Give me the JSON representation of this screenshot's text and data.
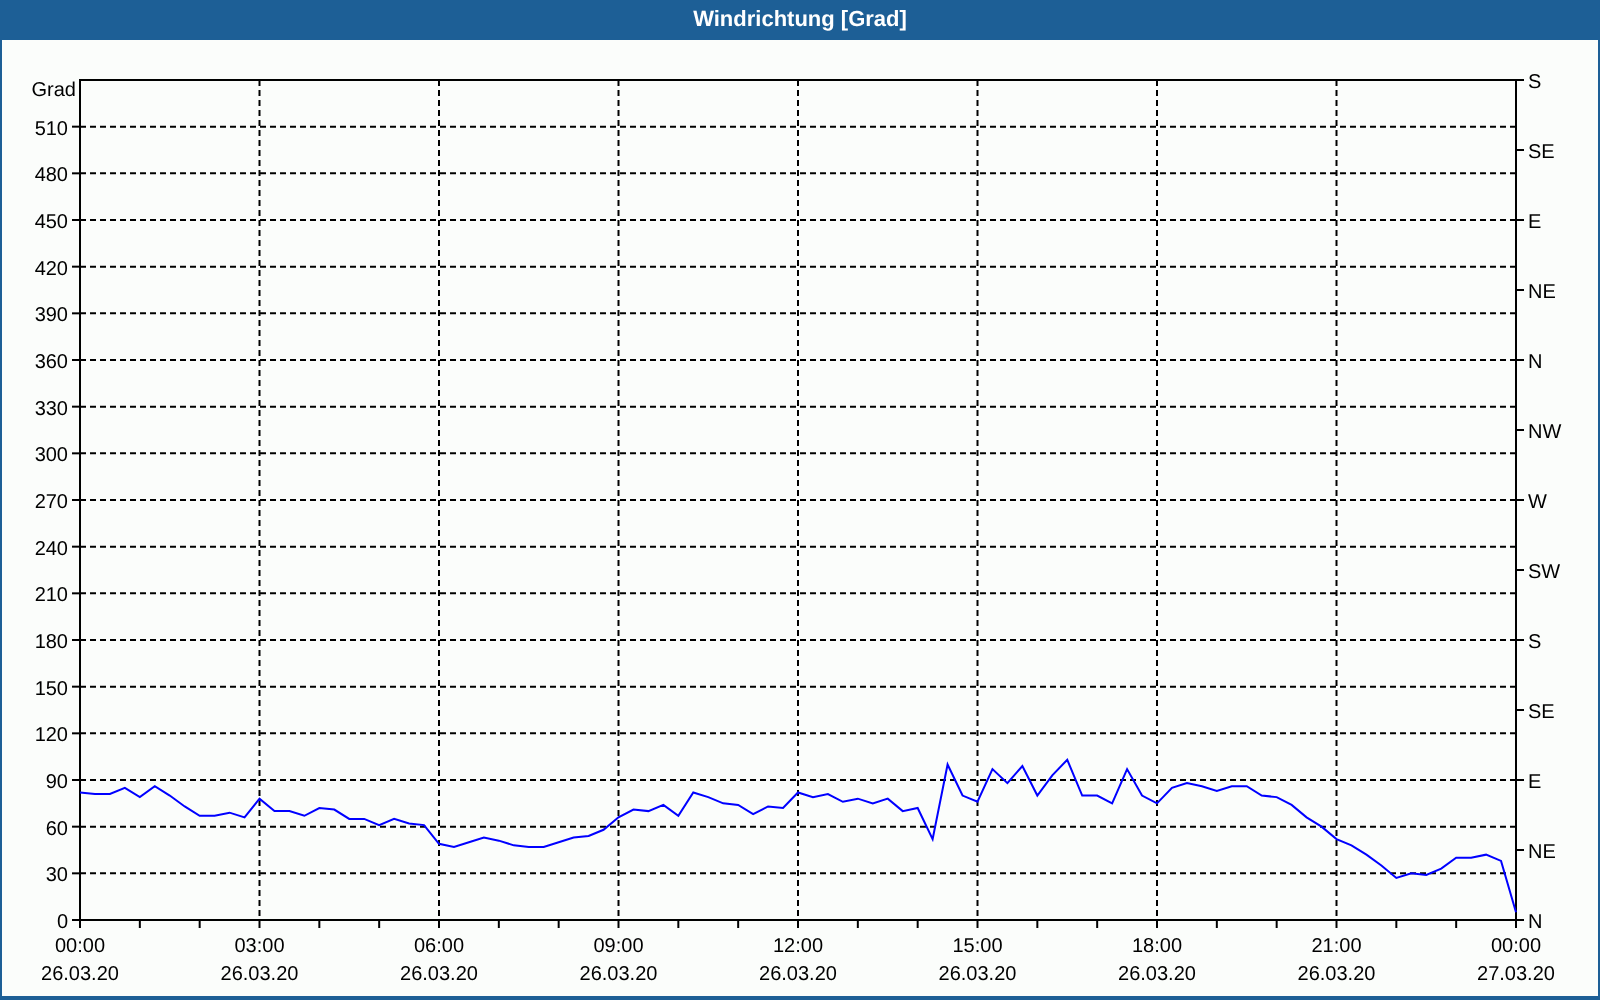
{
  "window": {
    "title": "Windrichtung [Grad]"
  },
  "chart": {
    "chart_data": {
      "type": "line",
      "ylabel": "Grad",
      "ylim": [
        0,
        540
      ],
      "categories": [
        "00:00 26.03.20",
        null,
        null,
        null,
        null,
        null,
        null,
        null,
        null,
        null,
        null,
        null,
        "03:00 26.03.20",
        null,
        null,
        null,
        null,
        null,
        null,
        null,
        null,
        null,
        null,
        null,
        "06:00 26.03.20",
        null,
        null,
        null,
        null,
        null,
        null,
        null,
        null,
        null,
        null,
        null,
        "09:00 26.03.20",
        null,
        null,
        null,
        null,
        null,
        null,
        null,
        null,
        null,
        null,
        null,
        "12:00 26.03.20",
        null,
        null,
        null,
        null,
        null,
        null,
        null,
        null,
        null,
        null,
        null,
        "15:00 26.03.20",
        null,
        null,
        null,
        null,
        null,
        null,
        null,
        null,
        null,
        null,
        null,
        "18:00 26.03.20",
        null,
        null,
        null,
        null,
        null,
        null,
        null,
        null,
        null,
        null,
        null,
        "21:00 26.03.20",
        null,
        null,
        null,
        null,
        null,
        null,
        null,
        null,
        null,
        null,
        null,
        "00:00 27.03.20"
      ],
      "series": [
        {
          "color": "#0000ff",
          "values": [
            82,
            81,
            81,
            85,
            79,
            86,
            80,
            73,
            67,
            67,
            69,
            66,
            78,
            70,
            70,
            67,
            72,
            71,
            65,
            65,
            61,
            65,
            62,
            61,
            49,
            47,
            50,
            53,
            51,
            48,
            47,
            47,
            50,
            53,
            54,
            58,
            66,
            71,
            70,
            74,
            67,
            82,
            79,
            75,
            74,
            68,
            73,
            72,
            82,
            79,
            81,
            76,
            78,
            75,
            78,
            70,
            72,
            52,
            100,
            80,
            76,
            97,
            88,
            99,
            80,
            93,
            103,
            80,
            80,
            75,
            97,
            80,
            75,
            85,
            88,
            86,
            83,
            86,
            86,
            80,
            79,
            74,
            66,
            60,
            52,
            48,
            42,
            35,
            27,
            30,
            29,
            33,
            40,
            40,
            42,
            38,
            5
          ]
        }
      ],
      "yticks": [
        0,
        30,
        60,
        90,
        120,
        150,
        180,
        210,
        240,
        270,
        300,
        330,
        360,
        390,
        420,
        450,
        480,
        510
      ],
      "grid": true
    },
    "right_axis": [
      "S",
      "SE",
      "E",
      "NE",
      "N",
      "NW",
      "W",
      "SW",
      "S",
      "SE",
      "E",
      "NE",
      "N"
    ]
  }
}
